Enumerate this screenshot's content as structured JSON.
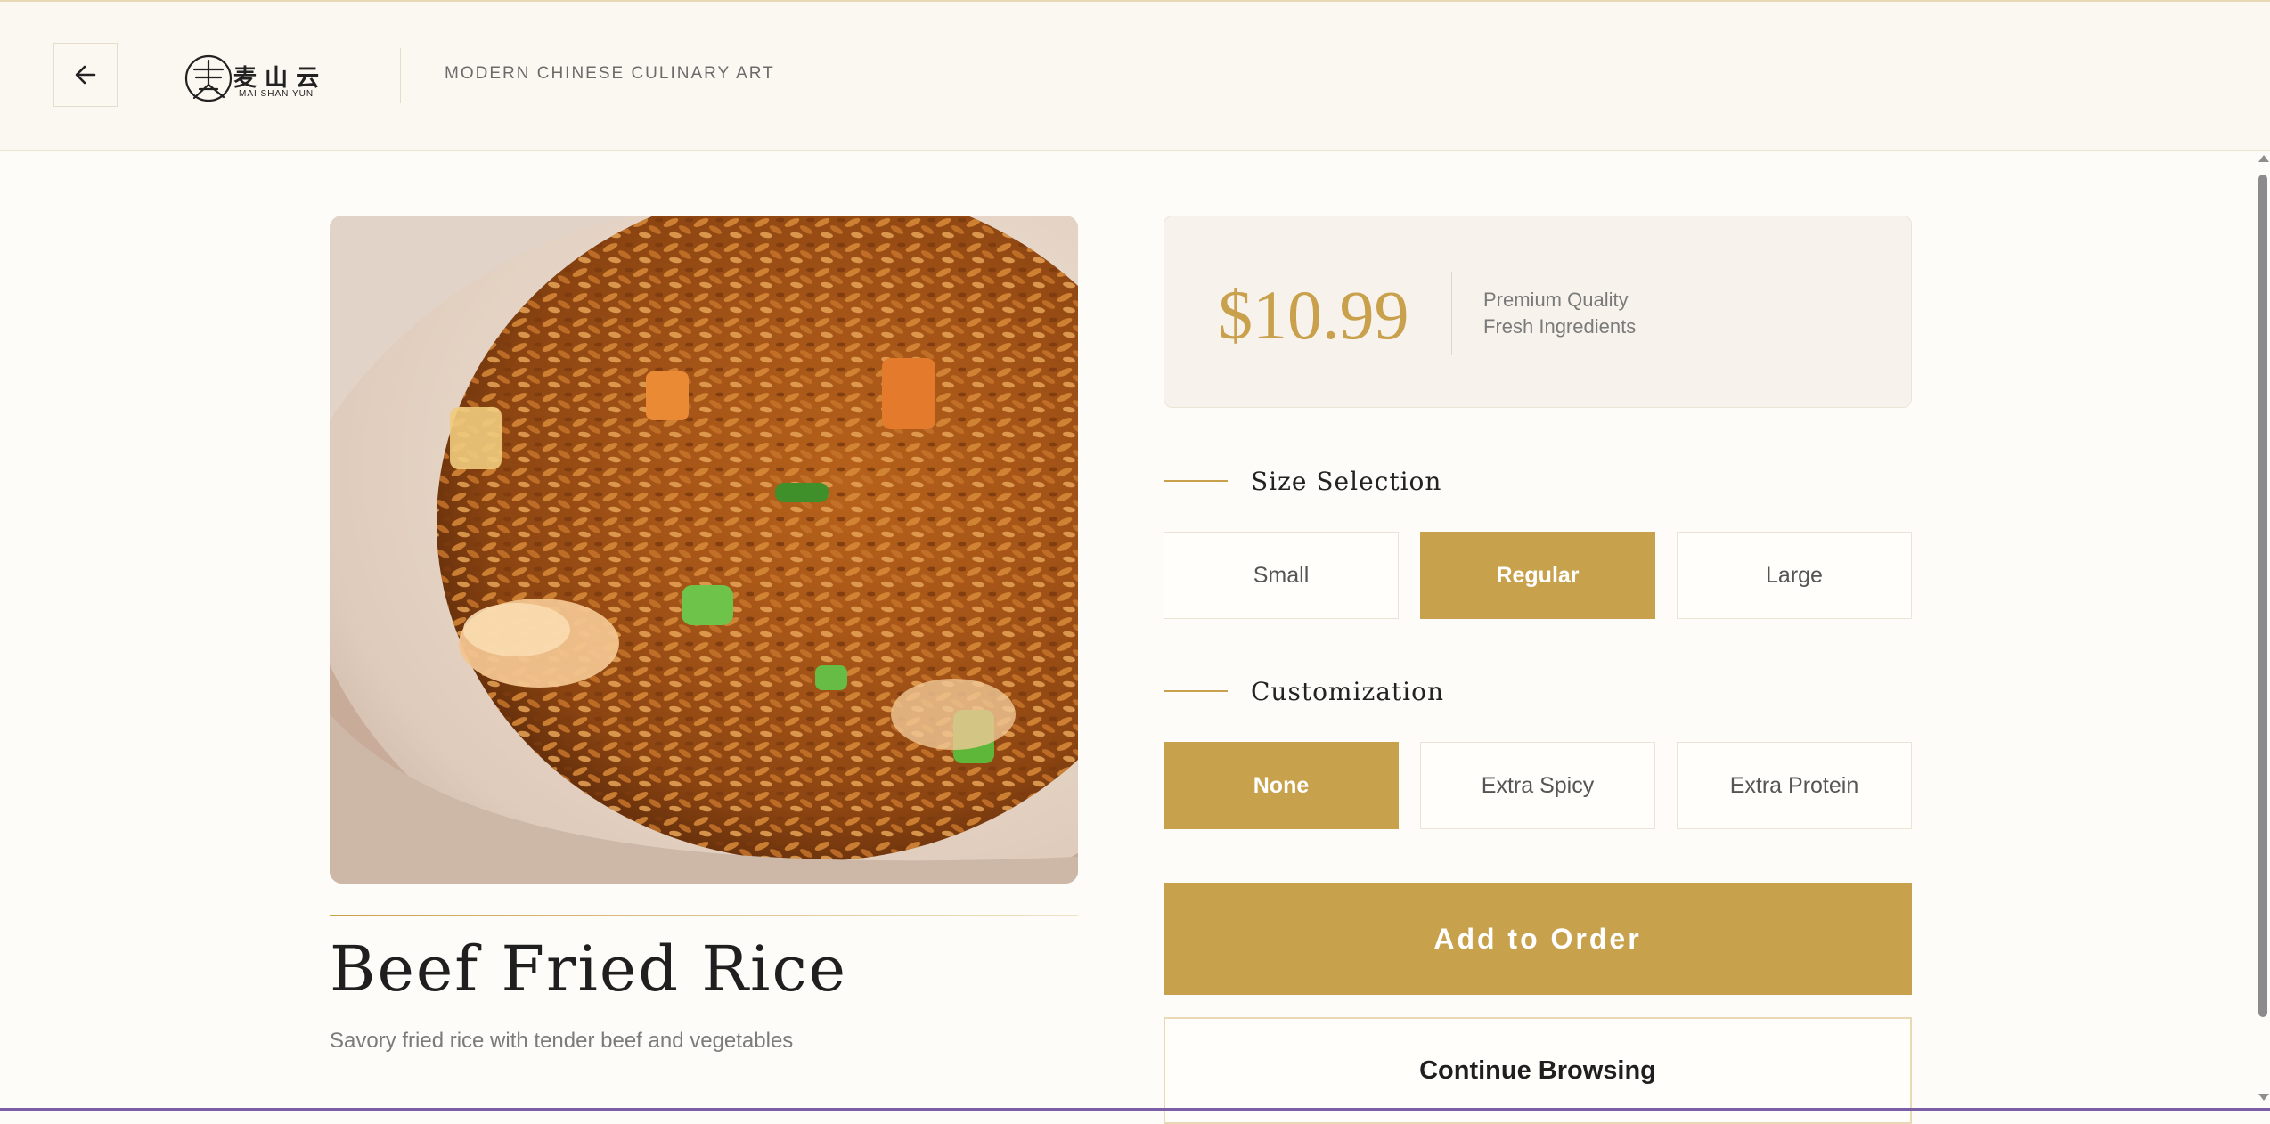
{
  "header": {
    "back_icon": "arrow-left-icon",
    "logo_text": "麦 山 云",
    "logo_sub": "MAI SHAN YUN",
    "tagline": "MODERN CHINESE CULINARY ART"
  },
  "dish": {
    "title": "Beef Fried Rice",
    "description": "Savory fried rice with tender beef and vegetables",
    "image": "beef-fried-rice-photo"
  },
  "price": {
    "amount": "$10.99",
    "line1": "Premium Quality",
    "line2": "Fresh Ingredients"
  },
  "size": {
    "title": "Size Selection",
    "options": [
      "Small",
      "Regular",
      "Large"
    ],
    "selected": "Regular"
  },
  "custom": {
    "title": "Customization",
    "options": [
      "None",
      "Extra Spicy",
      "Extra Protein"
    ],
    "selected": "None"
  },
  "actions": {
    "add": "Add to Order",
    "continue": "Continue Browsing"
  },
  "colors": {
    "accent": "#c8a14c",
    "background": "#fdfcf8"
  }
}
